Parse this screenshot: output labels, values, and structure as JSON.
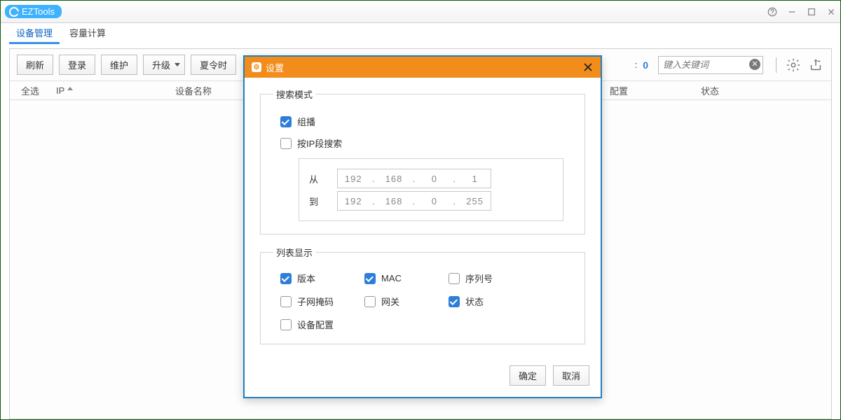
{
  "titlebar": {
    "app_name": "EZTools"
  },
  "tabs": [
    {
      "label": "设备管理",
      "active": true
    },
    {
      "label": "容量计算",
      "active": false
    }
  ],
  "toolbar": {
    "refresh": "刷新",
    "login": "登录",
    "maintain": "维护",
    "upgrade": "升级",
    "dst": "夏令时",
    "count": "0",
    "search_placeholder": "键入关键词"
  },
  "columns": {
    "select_all": "全选",
    "ip": "IP",
    "device_name": "设备名称",
    "config": "配置",
    "status": "状态"
  },
  "dialog": {
    "title": "设置",
    "search_mode": {
      "legend": "搜索模式",
      "multicast": "组播",
      "by_ip_range": "按IP段搜索",
      "from_label": "从",
      "to_label": "到",
      "from_ip": [
        "192",
        "168",
        "0",
        "1"
      ],
      "to_ip": [
        "192",
        "168",
        "0",
        "255"
      ]
    },
    "list_display": {
      "legend": "列表显示",
      "version": "版本",
      "mac": "MAC",
      "serial": "序列号",
      "subnet": "子网掩码",
      "gateway": "网关",
      "status": "状态",
      "device_config": "设备配置"
    },
    "ok": "确定",
    "cancel": "取消"
  }
}
